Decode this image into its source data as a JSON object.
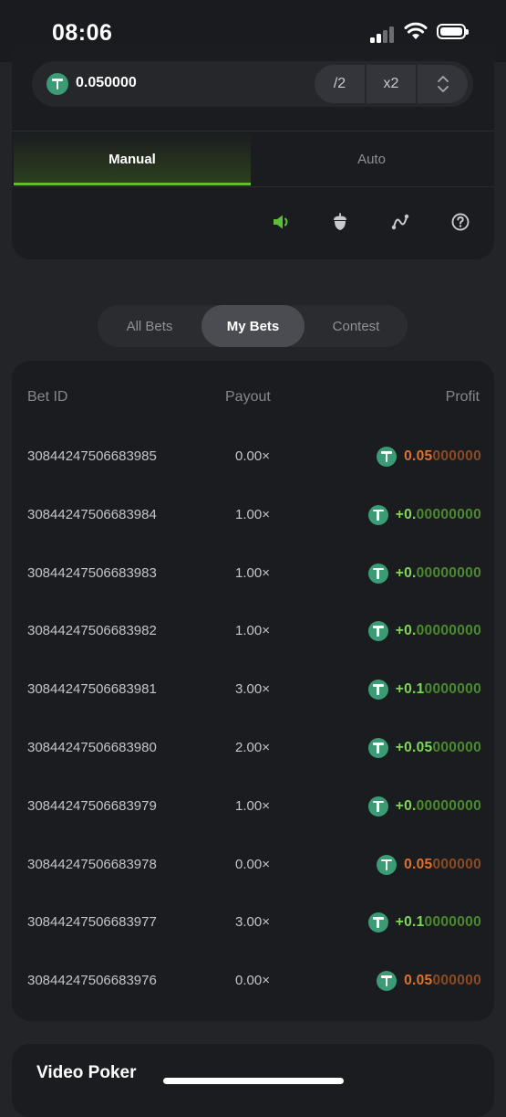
{
  "status_bar": {
    "time": "08:06"
  },
  "bet_amount": {
    "value": "0.050000",
    "half_label": "/2",
    "double_label": "x2"
  },
  "mode_tabs": {
    "manual": "Manual",
    "auto": "Auto",
    "active": "Manual"
  },
  "toolbar_icons": [
    "sound-icon",
    "acorn-icon",
    "graph-icon",
    "help-icon"
  ],
  "bet_tabs": {
    "items": [
      "All Bets",
      "My Bets",
      "Contest"
    ],
    "active": "My Bets"
  },
  "bets_table": {
    "headers": {
      "bet_id": "Bet ID",
      "payout": "Payout",
      "profit": "Profit"
    },
    "rows": [
      {
        "id": "30844247506683985",
        "payout": "0.00×",
        "profit_bright": "0.05",
        "profit_dim": "000000",
        "tone": "loss"
      },
      {
        "id": "30844247506683984",
        "payout": "1.00×",
        "profit_bright": "+0.",
        "profit_dim": "00000000",
        "tone": "win"
      },
      {
        "id": "30844247506683983",
        "payout": "1.00×",
        "profit_bright": "+0.",
        "profit_dim": "00000000",
        "tone": "win"
      },
      {
        "id": "30844247506683982",
        "payout": "1.00×",
        "profit_bright": "+0.",
        "profit_dim": "00000000",
        "tone": "win"
      },
      {
        "id": "30844247506683981",
        "payout": "3.00×",
        "profit_bright": "+0.1",
        "profit_dim": "0000000",
        "tone": "win"
      },
      {
        "id": "30844247506683980",
        "payout": "2.00×",
        "profit_bright": "+0.05",
        "profit_dim": "000000",
        "tone": "win"
      },
      {
        "id": "30844247506683979",
        "payout": "1.00×",
        "profit_bright": "+0.",
        "profit_dim": "00000000",
        "tone": "win"
      },
      {
        "id": "30844247506683978",
        "payout": "0.00×",
        "profit_bright": "0.05",
        "profit_dim": "000000",
        "tone": "loss"
      },
      {
        "id": "30844247506683977",
        "payout": "3.00×",
        "profit_bright": "+0.1",
        "profit_dim": "0000000",
        "tone": "win"
      },
      {
        "id": "30844247506683976",
        "payout": "0.00×",
        "profit_bright": "0.05",
        "profit_dim": "000000",
        "tone": "loss"
      }
    ]
  },
  "footer_section": {
    "title": "Video Poker"
  },
  "colors": {
    "accent_green": "#5fbe36",
    "win_green": "#7ed957",
    "loss_orange": "#e0712b",
    "tether": "#3a9b74"
  }
}
